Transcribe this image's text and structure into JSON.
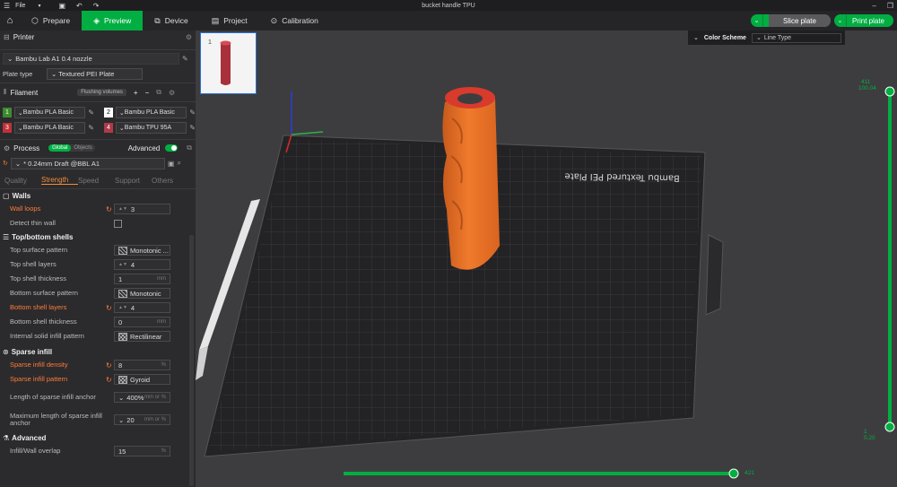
{
  "titlebar": {
    "menu_label": "File",
    "title": "bucket handle TPU"
  },
  "nav": {
    "tabs": [
      {
        "label": "Prepare"
      },
      {
        "label": "Preview"
      },
      {
        "label": "Device"
      },
      {
        "label": "Project"
      },
      {
        "label": "Calibration"
      }
    ],
    "slice_label": "Slice plate",
    "print_label": "Print plate"
  },
  "printer": {
    "section_title": "Printer",
    "printer_name": "Bambu Lab A1 0.4 nozzle",
    "plate_type_label": "Plate type",
    "plate_type_value": "Textured PEI Plate"
  },
  "filament": {
    "section_title": "Filament",
    "flushing_label": "Flushing volumes",
    "slots": [
      {
        "num": "1",
        "name": "Bambu PLA Basic",
        "color": "#3c8a2e"
      },
      {
        "num": "2",
        "name": "Bambu PLA Basic",
        "color": "#ffffff"
      },
      {
        "num": "3",
        "name": "Bambu PLA Basic",
        "color": "#c0303a"
      },
      {
        "num": "4",
        "name": "Bambu TPU 95A",
        "color": "#b03a4a"
      }
    ]
  },
  "process": {
    "section_title": "Process",
    "toggle_global": "Global",
    "toggle_objects": "Objects",
    "advanced_label": "Advanced",
    "preset": "* 0.24mm Draft @BBL A1",
    "tabs": [
      "Quality",
      "Strength",
      "Speed",
      "Support",
      "Others"
    ]
  },
  "params": {
    "walls_title": "Walls",
    "wall_loops": {
      "label": "Wall loops",
      "value": "3"
    },
    "detect_thin_wall": {
      "label": "Detect thin wall"
    },
    "topbottom_title": "Top/bottom shells",
    "top_surface_pattern": {
      "label": "Top surface pattern",
      "value": "Monotonic ..."
    },
    "top_shell_layers": {
      "label": "Top shell layers",
      "value": "4"
    },
    "top_shell_thickness": {
      "label": "Top shell thickness",
      "value": "1",
      "unit": "mm"
    },
    "bottom_surface_pattern": {
      "label": "Bottom surface pattern",
      "value": "Monotonic"
    },
    "bottom_shell_layers": {
      "label": "Bottom shell layers",
      "value": "4"
    },
    "bottom_shell_thickness": {
      "label": "Bottom shell thickness",
      "value": "0",
      "unit": "mm"
    },
    "internal_solid_infill_pattern": {
      "label": "Internal solid infill pattern",
      "value": "Rectilinear"
    },
    "sparse_title": "Sparse infill",
    "sparse_infill_density": {
      "label": "Sparse infill density",
      "value": "8",
      "unit": "%"
    },
    "sparse_infill_pattern": {
      "label": "Sparse infill pattern",
      "value": "Gyroid"
    },
    "length_anchor": {
      "label": "Length of sparse infill anchor",
      "value": "400%",
      "unit": "mm or %"
    },
    "max_length_anchor": {
      "label": "Maximum length of sparse infill anchor",
      "value": "20",
      "unit": "mm or %"
    },
    "advanced_title": "Advanced",
    "infill_wall_overlap": {
      "label": "Infill/Wall overlap",
      "value": "15",
      "unit": "%"
    }
  },
  "viewport": {
    "thumb_number": "1",
    "color_scheme_label": "Color Scheme",
    "color_scheme_value": "Line Type",
    "plate_text": "Bambu Textured PEI Plate",
    "layer_top": "411",
    "layer_top_height": "100.04",
    "layer_bottom": "1",
    "layer_bottom_height": "0.20",
    "hslider_value": "421"
  }
}
